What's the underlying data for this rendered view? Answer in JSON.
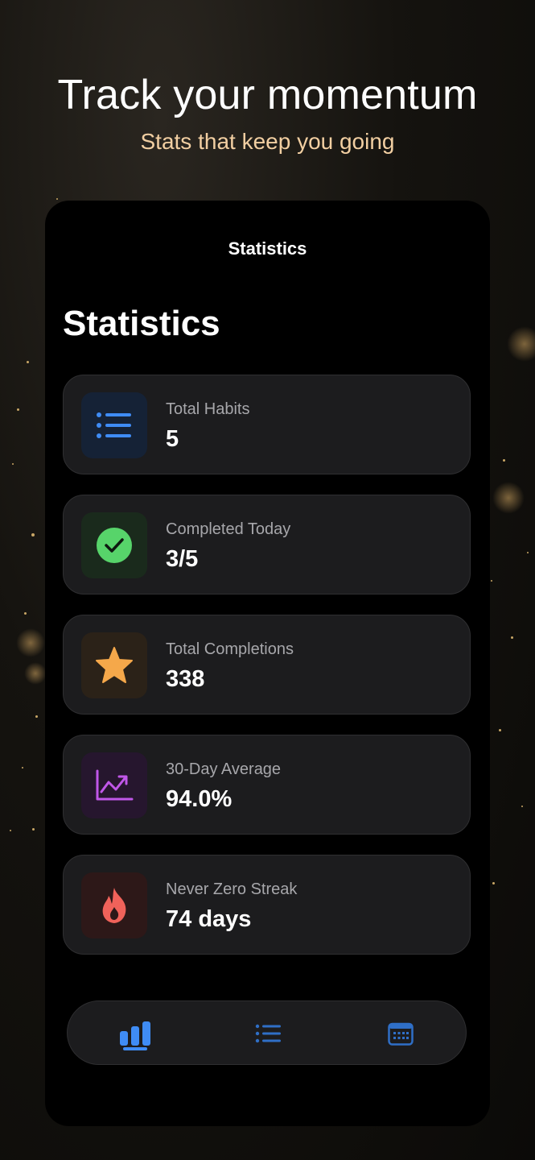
{
  "hero": {
    "title": "Track your momentum",
    "subtitle": "Stats that keep you going"
  },
  "screen": {
    "nav_title": "Statistics",
    "large_title": "Statistics"
  },
  "stats": [
    {
      "label": "Total Habits",
      "value": "5",
      "icon": "list-icon",
      "icon_color": "#3f8cf5",
      "icon_bg": "#152236"
    },
    {
      "label": "Completed Today",
      "value": "3/5",
      "icon": "checkmark-circle-icon",
      "icon_color": "#57d46a",
      "icon_bg": "#1a2a1c"
    },
    {
      "label": "Total Completions",
      "value": "338",
      "icon": "star-icon",
      "icon_color": "#f5a84a",
      "icon_bg": "#2b2218"
    },
    {
      "label": "30-Day Average",
      "value": "94.0%",
      "icon": "trend-chart-icon",
      "icon_color": "#c057e8",
      "icon_bg": "#26162e"
    },
    {
      "label": "Never Zero Streak",
      "value": "74 days",
      "icon": "flame-icon",
      "icon_color": "#f0625a",
      "icon_bg": "#2d1818"
    }
  ],
  "tabbar": {
    "active_tab": "statistics",
    "tabs": [
      {
        "name": "statistics",
        "icon": "bar-chart-icon"
      },
      {
        "name": "habits",
        "icon": "list-icon"
      },
      {
        "name": "calendar",
        "icon": "calendar-icon"
      }
    ],
    "accent": "#3f8cf5"
  }
}
